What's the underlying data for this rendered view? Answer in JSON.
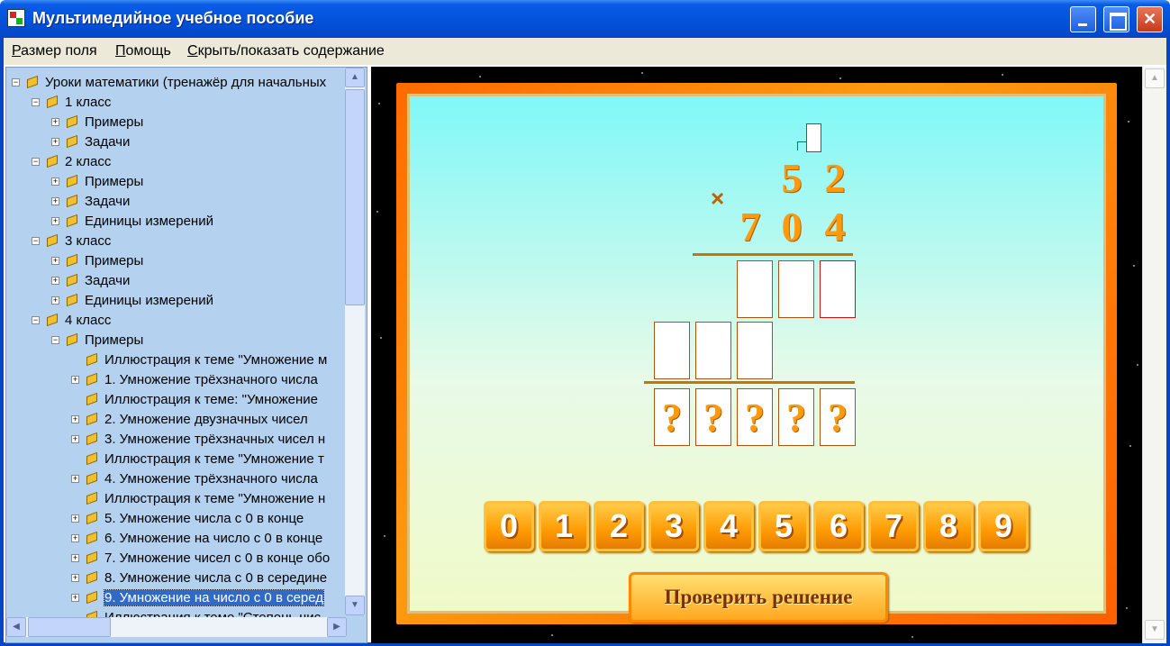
{
  "window": {
    "title": "Мультимедийное учебное пособие"
  },
  "menu": [
    {
      "label": "Размер поля"
    },
    {
      "label": "Помощь"
    },
    {
      "label": "Скрыть/показать содержание"
    }
  ],
  "tree": [
    {
      "label": "Уроки математики (тренажёр для начальных",
      "exp": "−",
      "level": 0
    },
    {
      "label": "1 класс",
      "exp": "−",
      "level": 1
    },
    {
      "label": "Примеры",
      "exp": "+",
      "level": 2
    },
    {
      "label": "Задачи",
      "exp": "+",
      "level": 2
    },
    {
      "label": "2 класс",
      "exp": "−",
      "level": 1
    },
    {
      "label": "Примеры",
      "exp": "+",
      "level": 2
    },
    {
      "label": "Задачи",
      "exp": "+",
      "level": 2
    },
    {
      "label": "Единицы измерений",
      "exp": "+",
      "level": 2
    },
    {
      "label": "3 класс",
      "exp": "−",
      "level": 1
    },
    {
      "label": "Примеры",
      "exp": "+",
      "level": 2
    },
    {
      "label": "Задачи",
      "exp": "+",
      "level": 2
    },
    {
      "label": "Единицы измерений",
      "exp": "+",
      "level": 2
    },
    {
      "label": "4 класс",
      "exp": "−",
      "level": 1
    },
    {
      "label": "Примеры",
      "exp": "−",
      "level": 2
    },
    {
      "label": "Иллюстрация к теме \"Умножение м",
      "exp": "",
      "level": 3
    },
    {
      "label": "1. Умножение трёхзначного числа",
      "exp": "+",
      "level": 3
    },
    {
      "label": "Иллюстрация к теме: \"Умножение",
      "exp": "",
      "level": 3
    },
    {
      "label": "2. Умножение двузначных чисел",
      "exp": "+",
      "level": 3
    },
    {
      "label": "3. Умножение трёхзначных чисел н",
      "exp": "+",
      "level": 3
    },
    {
      "label": "Иллюстрация к теме \"Умножение т",
      "exp": "",
      "level": 3
    },
    {
      "label": "4. Умножение трёхзначного числа",
      "exp": "+",
      "level": 3
    },
    {
      "label": "Иллюстрация к теме \"Умножение н",
      "exp": "",
      "level": 3
    },
    {
      "label": "5. Умножение числа с 0 в конце",
      "exp": "+",
      "level": 3
    },
    {
      "label": "6. Умножение на число с 0 в конце",
      "exp": "+",
      "level": 3
    },
    {
      "label": "7. Умножение чисел с 0 в конце обо",
      "exp": "+",
      "level": 3
    },
    {
      "label": "8. Умножение числа с 0 в середине",
      "exp": "+",
      "level": 3
    },
    {
      "label": "9. Умножение на число с 0 в серед",
      "exp": "+",
      "level": 3,
      "selected": true
    },
    {
      "label": "Иллюстрация к теме \"Степень чис",
      "exp": "",
      "level": 3
    }
  ],
  "problem": {
    "multiplicand": [
      "5",
      "2"
    ],
    "multiplier": [
      "7",
      "0",
      "4"
    ],
    "operator": "×",
    "result_placeholders": [
      "?",
      "?",
      "?",
      "?",
      "?"
    ]
  },
  "keypad": [
    "0",
    "1",
    "2",
    "3",
    "4",
    "5",
    "6",
    "7",
    "8",
    "9"
  ],
  "check_button": "Проверить решение"
}
